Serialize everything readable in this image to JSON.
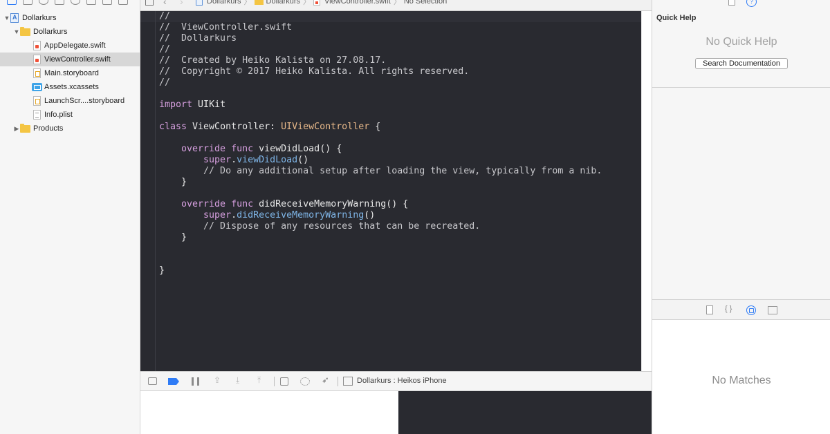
{
  "jump_bar": {
    "crumbs": [
      "Dollarkurs",
      "Dollarkurs",
      "ViewController.swift",
      "No Selection"
    ]
  },
  "navigator": {
    "items": [
      {
        "label": "Dollarkurs",
        "kind": "project",
        "expanded": true,
        "selected": false
      },
      {
        "label": "Dollarkurs",
        "kind": "folder",
        "expanded": true,
        "selected": false
      },
      {
        "label": "AppDelegate.swift",
        "kind": "swift-file",
        "selected": false
      },
      {
        "label": "ViewController.swift",
        "kind": "swift-file",
        "selected": true
      },
      {
        "label": "Main.storyboard",
        "kind": "storyboard-file",
        "selected": false
      },
      {
        "label": "Assets.xcassets",
        "kind": "assets",
        "selected": false
      },
      {
        "label": "LaunchScr....storyboard",
        "kind": "storyboard-file",
        "selected": false
      },
      {
        "label": "Info.plist",
        "kind": "plist-file",
        "selected": false
      },
      {
        "label": "Products",
        "kind": "folder",
        "expanded": false,
        "selected": false
      }
    ]
  },
  "editor": {
    "lines": [
      [
        {
          "t": "//",
          "c": "comment-light"
        }
      ],
      [
        {
          "t": "//  ViewController.swift",
          "c": "comment-light"
        }
      ],
      [
        {
          "t": "//  Dollarkurs",
          "c": "comment-light"
        }
      ],
      [
        {
          "t": "//",
          "c": "comment-light"
        }
      ],
      [
        {
          "t": "//  Created by Heiko Kalista on 27.08.17.",
          "c": "comment-light"
        }
      ],
      [
        {
          "t": "//  Copyright © 2017 Heiko Kalista. All rights reserved.",
          "c": "comment-light"
        }
      ],
      [
        {
          "t": "//",
          "c": "comment-light"
        }
      ],
      [],
      [
        {
          "t": "import",
          "c": "kw"
        },
        {
          "t": " UIKit",
          "c": "plain"
        }
      ],
      [],
      [
        {
          "t": "class",
          "c": "kw"
        },
        {
          "t": " ViewController: ",
          "c": "plain"
        },
        {
          "t": "UIViewController",
          "c": "type"
        },
        {
          "t": " {",
          "c": "plain"
        }
      ],
      [],
      [
        {
          "t": "    override",
          "c": "kw"
        },
        {
          "t": " ",
          "c": "plain"
        },
        {
          "t": "func",
          "c": "kw"
        },
        {
          "t": " viewDidLoad() {",
          "c": "plain"
        }
      ],
      [
        {
          "t": "        super",
          "c": "kw"
        },
        {
          "t": ".",
          "c": "plain"
        },
        {
          "t": "viewDidLoad",
          "c": "call"
        },
        {
          "t": "()",
          "c": "plain"
        }
      ],
      [
        {
          "t": "        // Do any additional setup after loading the view, typically from a nib.",
          "c": "comment-light"
        }
      ],
      [
        {
          "t": "    }",
          "c": "plain"
        }
      ],
      [],
      [
        {
          "t": "    override",
          "c": "kw"
        },
        {
          "t": " ",
          "c": "plain"
        },
        {
          "t": "func",
          "c": "kw"
        },
        {
          "t": " didReceiveMemoryWarning() {",
          "c": "plain"
        }
      ],
      [
        {
          "t": "        super",
          "c": "kw"
        },
        {
          "t": ".",
          "c": "plain"
        },
        {
          "t": "didReceiveMemoryWarning",
          "c": "call"
        },
        {
          "t": "()",
          "c": "plain"
        }
      ],
      [
        {
          "t": "        // Dispose of any resources that can be recreated.",
          "c": "comment-light"
        }
      ],
      [
        {
          "t": "    }",
          "c": "plain"
        }
      ],
      [],
      [],
      [
        {
          "t": "}",
          "c": "plain"
        }
      ]
    ]
  },
  "debug_bar": {
    "target_label": "Dollarkurs : Heikos iPhone"
  },
  "utilities": {
    "quick_help_title": "Quick Help",
    "no_quick_help": "No Quick Help",
    "search_documentation": "Search Documentation",
    "no_matches": "No Matches"
  },
  "colors": {
    "editor_background": "#292a30",
    "keyword": "#d7a0e0",
    "type": "#e8b98a",
    "call": "#7fb6e8",
    "comment": "#c8c8cc",
    "accent": "#2f7cf6"
  }
}
